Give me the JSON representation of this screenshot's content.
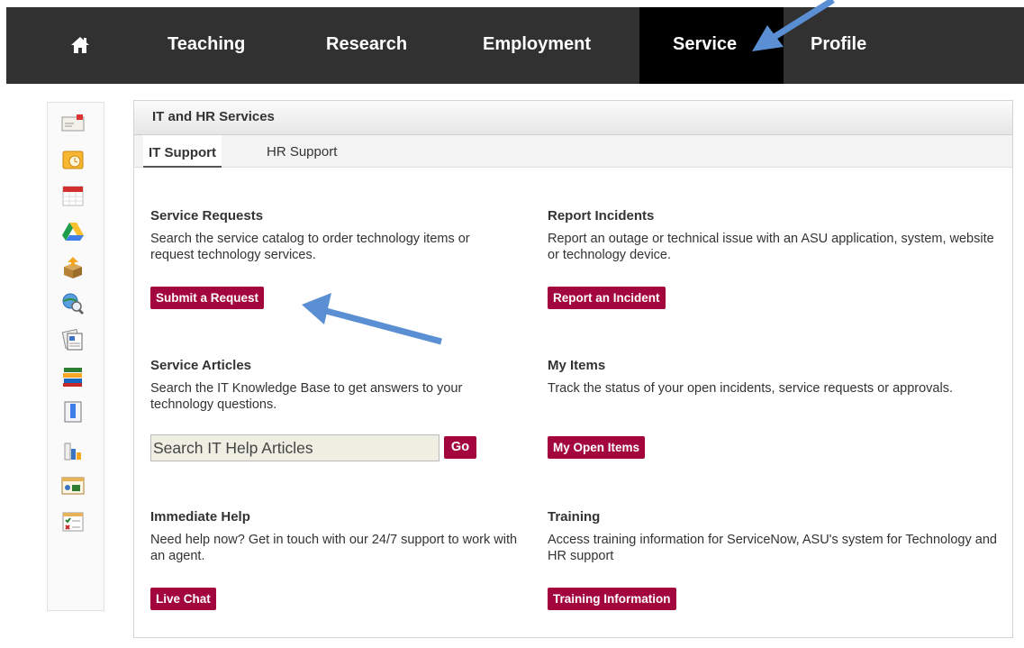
{
  "nav": {
    "home_icon": "home-icon",
    "items": [
      "Teaching",
      "Research",
      "Employment",
      "Service",
      "Profile"
    ],
    "active": "Service"
  },
  "rail_icons": [
    "mail-icon",
    "outlook-icon",
    "calendar-icon",
    "google-drive-icon",
    "box-upload-icon",
    "globe-search-icon",
    "news-icon",
    "books-icon",
    "document-icon",
    "bar-chart-icon",
    "presentation-icon",
    "checklist-icon"
  ],
  "panel": {
    "title": "IT and HR Services",
    "tabs": [
      "IT Support",
      "HR Support"
    ]
  },
  "sections": {
    "service_requests": {
      "title": "Service Requests",
      "desc": "Search the service catalog to order technology items or request technology services.",
      "button": "Submit a Request"
    },
    "report_incidents": {
      "title": "Report Incidents",
      "desc": "Report an outage or technical issue with an ASU application, system, website or technology device.",
      "button": "Report an Incident"
    },
    "service_articles": {
      "title": "Service Articles",
      "desc": "Search the IT Knowledge Base to get answers to your technology questions.",
      "search_placeholder": "Search IT Help Articles",
      "button": "Go"
    },
    "my_items": {
      "title": "My Items",
      "desc": "Track the status of your open incidents, service requests or approvals.",
      "button": "My Open Items"
    },
    "immediate_help": {
      "title": "Immediate Help",
      "desc": "Need help now? Get in touch with our 24/7 support to work with an agent.",
      "button": "Live Chat"
    },
    "training": {
      "title": "Training",
      "desc": "Access training information for ServiceNow, ASU's system for Technology and HR support",
      "button": "Training Information"
    }
  },
  "colors": {
    "nav_bg": "#313131",
    "nav_active_bg": "#000000",
    "button": "#a3063d",
    "annotation_arrow": "#5b8fd4"
  }
}
